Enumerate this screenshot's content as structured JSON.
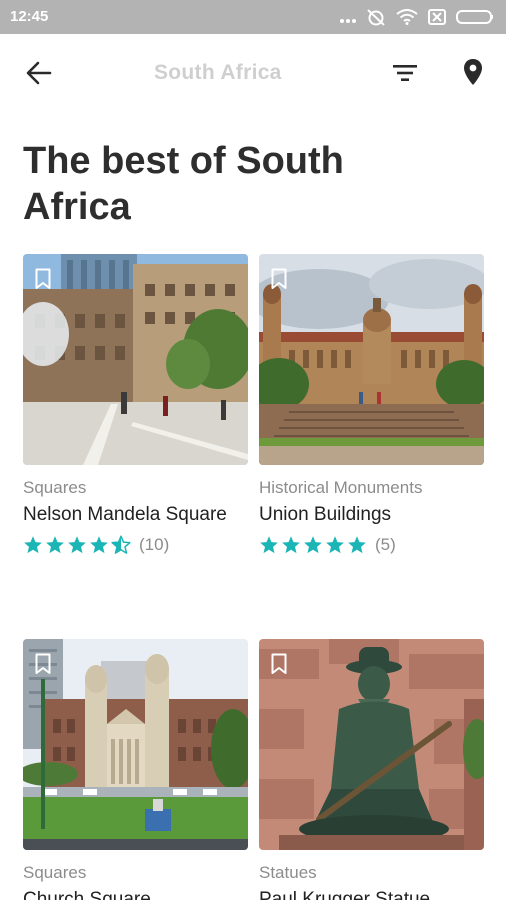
{
  "status_bar": {
    "time": "12:45",
    "icons": [
      "more-dots-icon",
      "no-alarm-icon",
      "wifi-icon",
      "sim-off-icon",
      "battery-icon"
    ]
  },
  "app_bar": {
    "title": "South Africa",
    "back_icon": "arrow-left-icon",
    "filter_icon": "filter-icon",
    "location_icon": "map-pin-icon"
  },
  "page_title": "The best of South Africa",
  "colors": {
    "accent_star": "#1cb5b5",
    "title": "#2e2e2e",
    "category": "#8c8c8c",
    "status_bar": "#b3b3b3"
  },
  "places": [
    {
      "category": "Squares",
      "name": "Nelson Mandela Square",
      "rating": 4.5,
      "reviews": "(10)",
      "image": "plaza-with-office-buildings"
    },
    {
      "category": "Historical Monuments",
      "name": "Union Buildings",
      "rating": 5,
      "reviews": "(5)",
      "image": "sandstone-government-building-with-steps"
    },
    {
      "category": "Squares",
      "name": "Church Square",
      "image": "historic-building-behind-lawn"
    },
    {
      "category": "Statues",
      "name": "Paul Krugger Statue",
      "image": "bronze-seated-statue"
    }
  ]
}
